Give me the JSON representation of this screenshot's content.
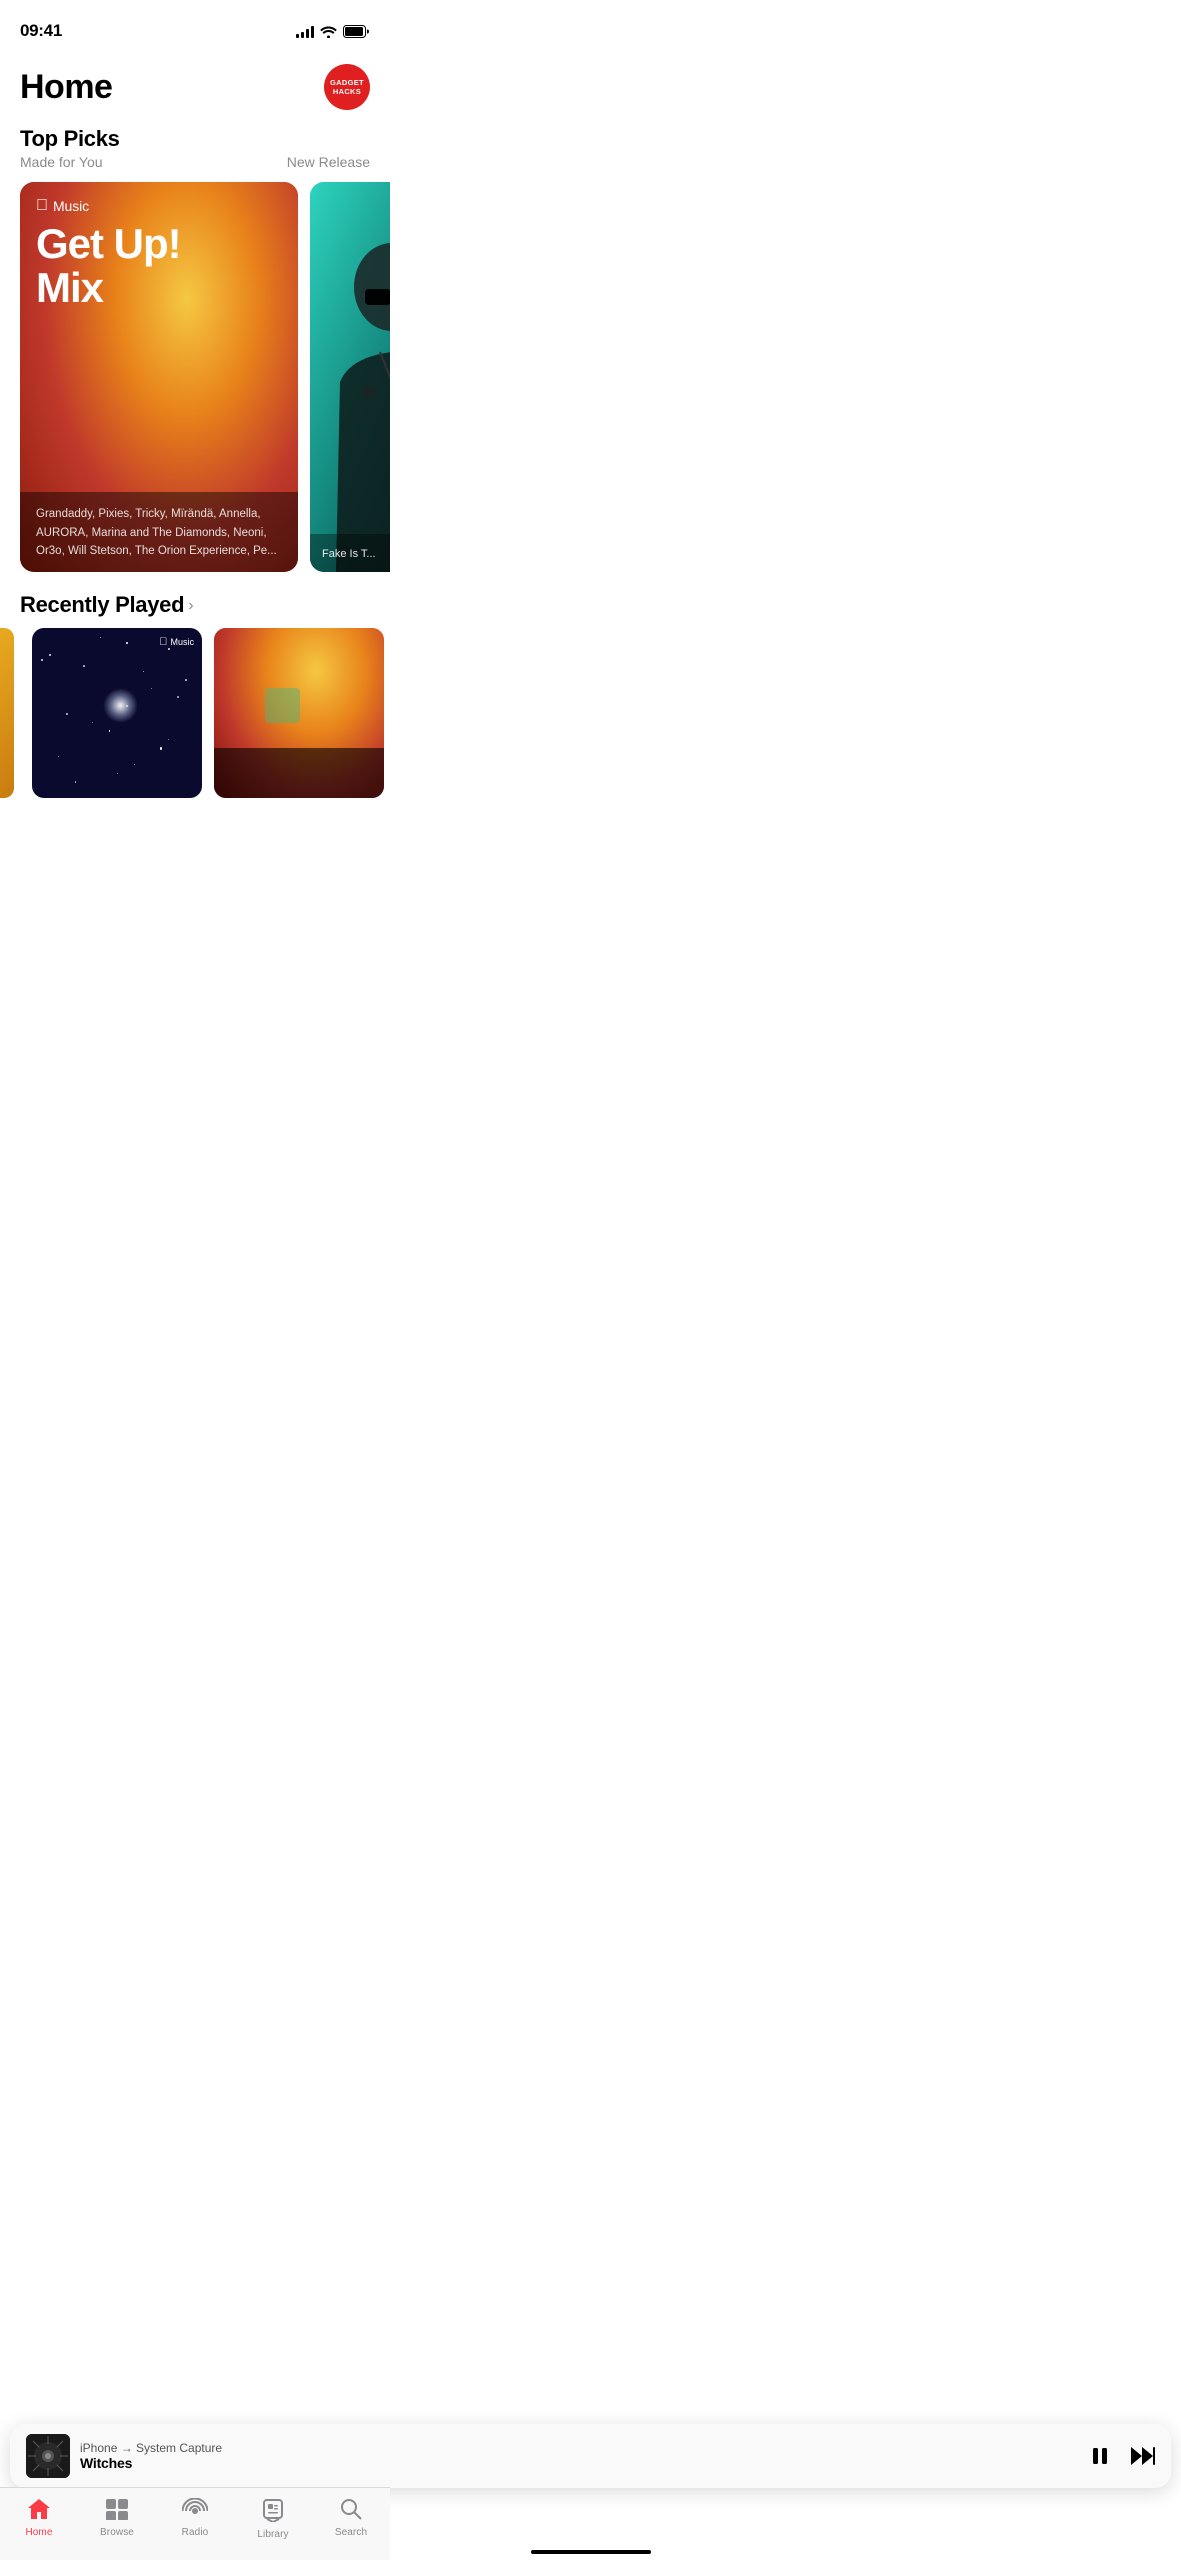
{
  "statusBar": {
    "time": "09:41"
  },
  "header": {
    "title": "Home",
    "badge": {
      "line1": "GADGET",
      "line2": "HACKS"
    }
  },
  "topPicks": {
    "sectionTitle": "Top Picks",
    "subtitleLeft": "Made for You",
    "subtitleRight": "New Release",
    "mainCard": {
      "appleMusic": "Music",
      "titleLine1": "Get Up!",
      "titleLine2": "Mix",
      "description": "Grandaddy, Pixies, Tricky, Mïrändä, Annella, AURORA, Marina and The Diamonds, Neoni, Or3o, Will Stetson, The Orion Experience, Pe..."
    },
    "sideCard": {
      "label": "Fake Is T..."
    }
  },
  "recentlyPlayed": {
    "title": "Recently Played"
  },
  "nowPlaying": {
    "route": "iPhone → System Capture",
    "song": "Witches",
    "arrow": "→"
  },
  "tabBar": {
    "tabs": [
      {
        "id": "home",
        "label": "Home",
        "active": true
      },
      {
        "id": "browse",
        "label": "Browse",
        "active": false
      },
      {
        "id": "radio",
        "label": "Radio",
        "active": false
      },
      {
        "id": "library",
        "label": "Library",
        "active": false
      },
      {
        "id": "search",
        "label": "Search",
        "active": false
      }
    ]
  }
}
